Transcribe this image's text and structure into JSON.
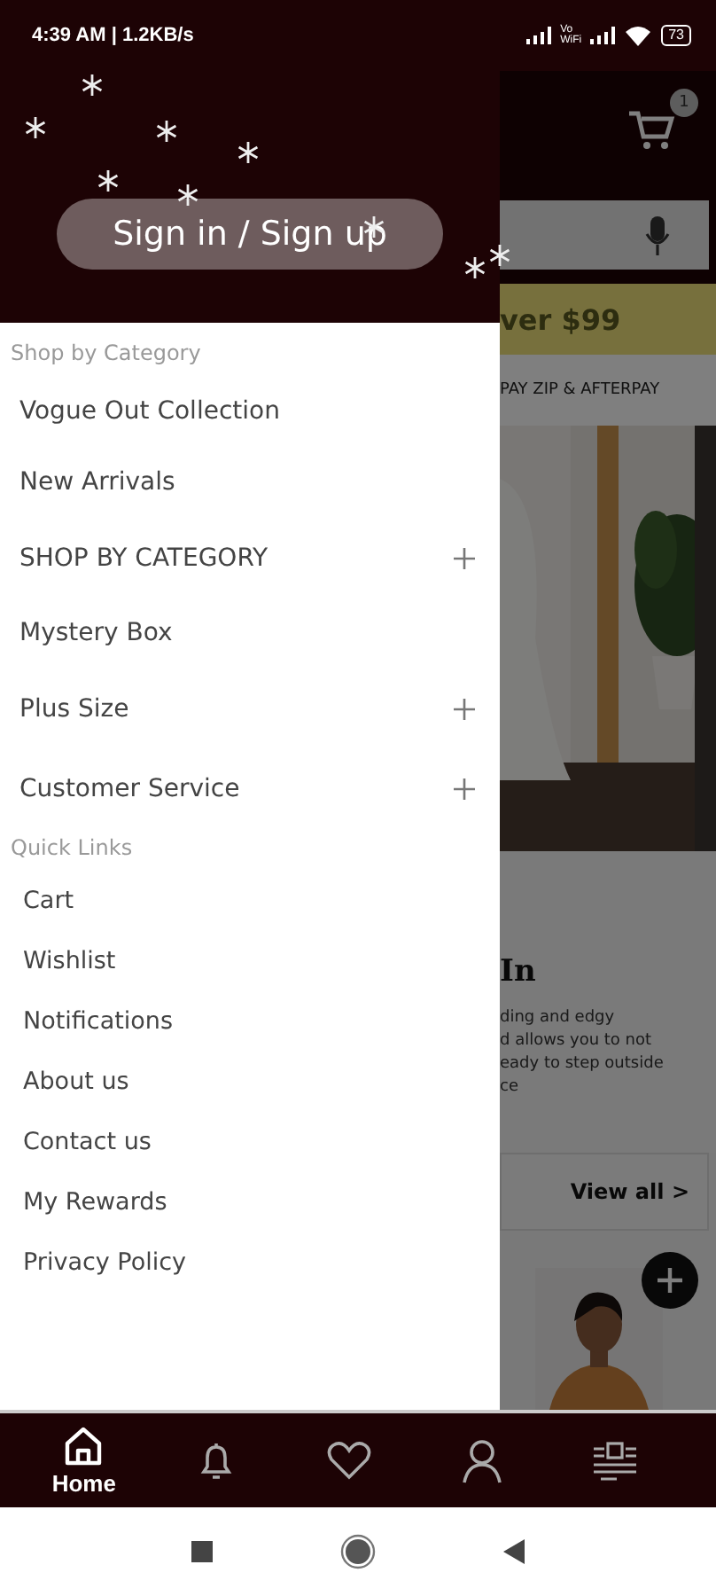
{
  "status_bar": {
    "time": "4:39 AM | 1.2KB/s",
    "network_label": "Vo\nWiFi",
    "battery": "73"
  },
  "background_page": {
    "cart_count": "1",
    "banner": "ver $99",
    "payment_note": "PAY ZIP & AFTERPAY",
    "heading": "In",
    "description_lines": [
      "ding and edgy",
      "d allows you to not",
      "eady to step outside",
      "ce"
    ],
    "view_all": "View all >"
  },
  "drawer": {
    "sign_in_button": "Sign in / Sign up",
    "sections": [
      {
        "title": "Shop by Category",
        "items": [
          {
            "label": "Vogue Out Collection",
            "expandable": false
          },
          {
            "label": "New Arrivals",
            "expandable": false
          },
          {
            "label": "SHOP BY CATEGORY",
            "expandable": true
          },
          {
            "label": "Mystery Box",
            "expandable": false
          },
          {
            "label": "Plus Size",
            "expandable": true
          },
          {
            "label": "Customer Service",
            "expandable": true
          }
        ]
      },
      {
        "title": "Quick Links",
        "items": [
          {
            "label": "Cart",
            "expandable": false
          },
          {
            "label": "Wishlist",
            "expandable": false
          },
          {
            "label": "Notifications",
            "expandable": false
          },
          {
            "label": "About us",
            "expandable": false
          },
          {
            "label": "Contact us",
            "expandable": false
          },
          {
            "label": "My Rewards",
            "expandable": false
          },
          {
            "label": "Privacy Policy",
            "expandable": false
          }
        ]
      }
    ]
  },
  "bottom_nav": [
    {
      "kind": "home",
      "label": "Home",
      "selected": true
    },
    {
      "kind": "bell",
      "selected": false
    },
    {
      "kind": "heart",
      "selected": false
    },
    {
      "kind": "user",
      "selected": false
    },
    {
      "kind": "news",
      "selected": false
    }
  ]
}
